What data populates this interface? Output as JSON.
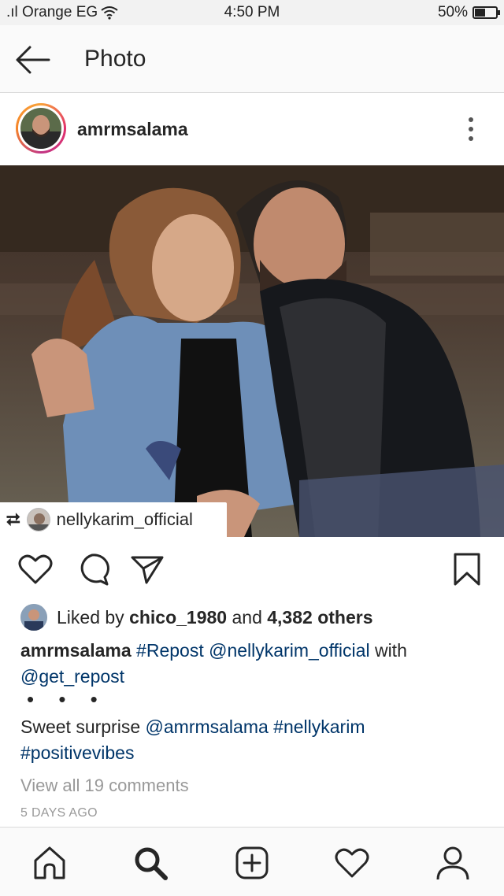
{
  "status_bar": {
    "carrier": ".ıl Orange EG",
    "time": "4:50 PM",
    "battery_percent": "50%",
    "battery_level": 0.5
  },
  "header": {
    "title": "Photo",
    "back_icon": "arrow-left-icon"
  },
  "post": {
    "username": "amrmsalama",
    "repost_user": "nellykarim_official",
    "liked_by_prefix": "Liked by ",
    "liked_by_user": "chico_1980",
    "liked_by_and": " and ",
    "liked_by_others": "4,382 others",
    "caption_user": "amrmsalama",
    "caption_hashtag_repost": "#Repost",
    "caption_mention_nelly": "@nellykarim_official",
    "caption_with": "with",
    "caption_mention_getrepost": "@get_repost",
    "more_marker": "• • •",
    "text_sweet": "Sweet surprise",
    "text_mention_amr": "@amrmsalama",
    "text_tag_nelly": "#nellykarim",
    "text_tag_vibes": "#positivevibes",
    "view_comments": "View all 19 comments",
    "time_ago": "5 DAYS AGO"
  },
  "colors": {
    "link": "#003569",
    "meta_gray": "#999999",
    "text": "#262626"
  },
  "icons": [
    "arrow-left-icon",
    "more-vertical-icon",
    "repost-icon",
    "heart-icon",
    "comment-icon",
    "share-icon",
    "bookmark-icon",
    "home-icon",
    "search-icon",
    "add-icon",
    "activity-icon",
    "profile-icon"
  ]
}
